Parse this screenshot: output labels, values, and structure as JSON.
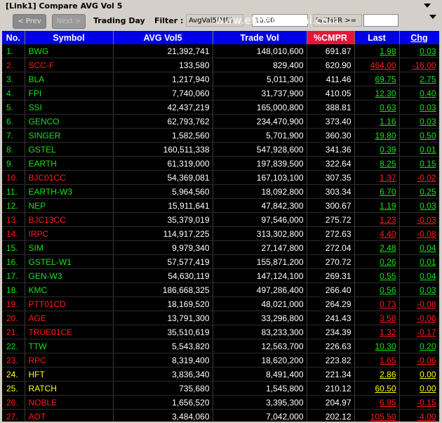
{
  "window": {
    "title": "[Link1] Compare AVG Vol 5"
  },
  "toolbar": {
    "prev_label": "< Prev",
    "next_label": "Next >",
    "trading_day_label": "Trading Day",
    "filter_label": "Filter :",
    "avgvol_label": "AvgVal5(MB) >=",
    "avgvol_value": "10.00",
    "cmpr_label": "%CMPR >=",
    "cmpr_value": ""
  },
  "watermark": "www.efinancethai.com",
  "columns": [
    "No.",
    "Symbol",
    "AVG Vol5",
    "Trade Vol",
    "%CMPR",
    "Last",
    "Chg"
  ],
  "colors": {
    "up": "#14e314",
    "down": "#ff1a1a",
    "unchanged": "#ffff00",
    "header_bg": "#0000e6",
    "cmpr_header_bg": "#e8143c"
  },
  "rows": [
    {
      "no": "1.",
      "symbol": "BWG",
      "avg": "21,392,741",
      "trade": "148,010,600",
      "cmpr": "691.87",
      "last": "1.98",
      "chg": "0.03",
      "dir": "up"
    },
    {
      "no": "2.",
      "symbol": "SCC-F",
      "avg": "133,580",
      "trade": "829,400",
      "cmpr": "620.90",
      "last": "464.00",
      "chg": "-16.00",
      "dir": "down"
    },
    {
      "no": "3.",
      "symbol": "BLA",
      "avg": "1,217,940",
      "trade": "5,011,300",
      "cmpr": "411.46",
      "last": "69.75",
      "chg": "2.75",
      "dir": "up"
    },
    {
      "no": "4.",
      "symbol": "FPI",
      "avg": "7,740,060",
      "trade": "31,737,900",
      "cmpr": "410.05",
      "last": "12.30",
      "chg": "0.40",
      "dir": "up"
    },
    {
      "no": "5.",
      "symbol": "SSI",
      "avg": "42,437,219",
      "trade": "165,000,800",
      "cmpr": "388.81",
      "last": "0.63",
      "chg": "0.03",
      "dir": "up"
    },
    {
      "no": "6.",
      "symbol": "GENCO",
      "avg": "62,793,762",
      "trade": "234,470,900",
      "cmpr": "373.40",
      "last": "1.16",
      "chg": "0.03",
      "dir": "up"
    },
    {
      "no": "7.",
      "symbol": "SINGER",
      "avg": "1,582,560",
      "trade": "5,701,900",
      "cmpr": "360.30",
      "last": "19.80",
      "chg": "0.50",
      "dir": "up"
    },
    {
      "no": "8.",
      "symbol": "GSTEL",
      "avg": "160,511,338",
      "trade": "547,928,600",
      "cmpr": "341.36",
      "last": "0.39",
      "chg": "0.01",
      "dir": "up"
    },
    {
      "no": "9.",
      "symbol": "EARTH",
      "avg": "61,319,000",
      "trade": "197,839,500",
      "cmpr": "322.64",
      "last": "8.25",
      "chg": "0.15",
      "dir": "up"
    },
    {
      "no": "10.",
      "symbol": "BJC01CC",
      "avg": "54,369,081",
      "trade": "167,103,100",
      "cmpr": "307.35",
      "last": "1.37",
      "chg": "-0.02",
      "dir": "down"
    },
    {
      "no": "11.",
      "symbol": "EARTH-W3",
      "avg": "5,964,560",
      "trade": "18,092,800",
      "cmpr": "303.34",
      "last": "6.70",
      "chg": "0.25",
      "dir": "up"
    },
    {
      "no": "12.",
      "symbol": "NEP",
      "avg": "15,911,641",
      "trade": "47,842,300",
      "cmpr": "300.67",
      "last": "1.19",
      "chg": "0.03",
      "dir": "up"
    },
    {
      "no": "13.",
      "symbol": "BJC13CC",
      "avg": "35,379,019",
      "trade": "97,546,000",
      "cmpr": "275.72",
      "last": "1.23",
      "chg": "-0.03",
      "dir": "down"
    },
    {
      "no": "14.",
      "symbol": "IRPC",
      "avg": "114,917,225",
      "trade": "313,302,800",
      "cmpr": "272.63",
      "last": "4.40",
      "chg": "-0.08",
      "dir": "down"
    },
    {
      "no": "15.",
      "symbol": "SIM",
      "avg": "9,979,340",
      "trade": "27,147,800",
      "cmpr": "272.04",
      "last": "2.48",
      "chg": "0.04",
      "dir": "up"
    },
    {
      "no": "16.",
      "symbol": "GSTEL-W1",
      "avg": "57,577,419",
      "trade": "155,871,200",
      "cmpr": "270.72",
      "last": "0.26",
      "chg": "0.01",
      "dir": "up"
    },
    {
      "no": "17.",
      "symbol": "GEN-W3",
      "avg": "54,630,119",
      "trade": "147,124,100",
      "cmpr": "269.31",
      "last": "0.55",
      "chg": "0.04",
      "dir": "up"
    },
    {
      "no": "18.",
      "symbol": "KMC",
      "avg": "186,668,325",
      "trade": "497,286,400",
      "cmpr": "266.40",
      "last": "0.56",
      "chg": "0.03",
      "dir": "up"
    },
    {
      "no": "19.",
      "symbol": "PTT01CD",
      "avg": "18,169,520",
      "trade": "48,021,000",
      "cmpr": "264.29",
      "last": "0.73",
      "chg": "-0.08",
      "dir": "down"
    },
    {
      "no": "20.",
      "symbol": "AGE",
      "avg": "13,791,300",
      "trade": "33,296,800",
      "cmpr": "241.43",
      "last": "3.58",
      "chg": "-0.06",
      "dir": "down"
    },
    {
      "no": "21.",
      "symbol": "TRUE01CE",
      "avg": "35,510,619",
      "trade": "83,233,300",
      "cmpr": "234.39",
      "last": "1.32",
      "chg": "-0.17",
      "dir": "down"
    },
    {
      "no": "22.",
      "symbol": "TTW",
      "avg": "5,543,820",
      "trade": "12,563,700",
      "cmpr": "226.63",
      "last": "10.30",
      "chg": "0.20",
      "dir": "up"
    },
    {
      "no": "23.",
      "symbol": "RPC",
      "avg": "8,319,400",
      "trade": "18,620,200",
      "cmpr": "223.82",
      "last": "1.65",
      "chg": "-0.06",
      "dir": "down"
    },
    {
      "no": "24.",
      "symbol": "HFT",
      "avg": "3,836,340",
      "trade": "8,491,400",
      "cmpr": "221.34",
      "last": "2.86",
      "chg": "0.00",
      "dir": "flat"
    },
    {
      "no": "25.",
      "symbol": "RATCH",
      "avg": "735,680",
      "trade": "1,545,800",
      "cmpr": "210.12",
      "last": "60.50",
      "chg": "0.00",
      "dir": "flat"
    },
    {
      "no": "26.",
      "symbol": "NOBLE",
      "avg": "1,656,520",
      "trade": "3,395,300",
      "cmpr": "204.97",
      "last": "6.95",
      "chg": "-0.15",
      "dir": "down"
    },
    {
      "no": "27.",
      "symbol": "AOT",
      "avg": "3,484,060",
      "trade": "7,042,000",
      "cmpr": "202.12",
      "last": "105.50",
      "chg": "-4.00",
      "dir": "down"
    }
  ]
}
